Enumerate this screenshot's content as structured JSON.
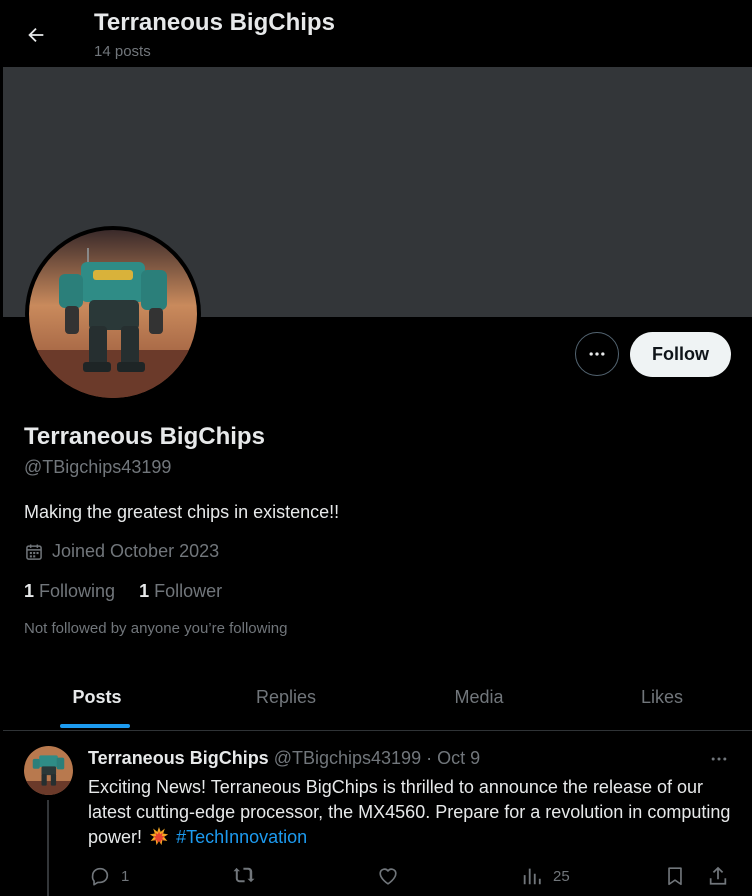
{
  "header": {
    "title": "Terraneous BigChips",
    "post_count": "14 posts"
  },
  "profile": {
    "display_name": "Terraneous BigChips",
    "handle": "@TBigchips43199",
    "bio": "Making the greatest chips in existence!!",
    "joined": "Joined October 2023",
    "following_count": "1",
    "following_label": "Following",
    "followers_count": "1",
    "followers_label": "Follower",
    "not_followed_text": "Not followed by anyone you’re following",
    "follow_label": "Follow"
  },
  "tabs": [
    {
      "label": "Posts",
      "active": true
    },
    {
      "label": "Replies",
      "active": false
    },
    {
      "label": "Media",
      "active": false
    },
    {
      "label": "Likes",
      "active": false
    }
  ],
  "post": {
    "author_name": "Terraneous BigChips",
    "author_meta": "@TBigchips43199 · Oct 9",
    "text_before_emoji": "Exciting News! Terraneous BigChips is thrilled to announce the release of our latest cutting-edge processor, the MX4560. Prepare for a revolution in computing power!",
    "emoji_name": "collision-emoji",
    "hashtag": "#TechInnovation",
    "actions": {
      "replies": "1",
      "reposts": "",
      "likes": "",
      "views": "25"
    }
  },
  "icons": {
    "back": "arrow-left-icon",
    "more": "more-horizontal-icon",
    "calendar": "calendar-icon",
    "reply": "reply-icon",
    "repost": "repost-icon",
    "like": "heart-icon",
    "views": "views-icon",
    "bookmark": "bookmark-icon",
    "share": "share-icon"
  },
  "colors": {
    "background": "#000000",
    "banner": "#333639",
    "accent": "#1d9bf0",
    "text_primary": "#e7e9ea",
    "text_secondary": "#71767b",
    "follow_button_bg": "#eff3f4"
  }
}
